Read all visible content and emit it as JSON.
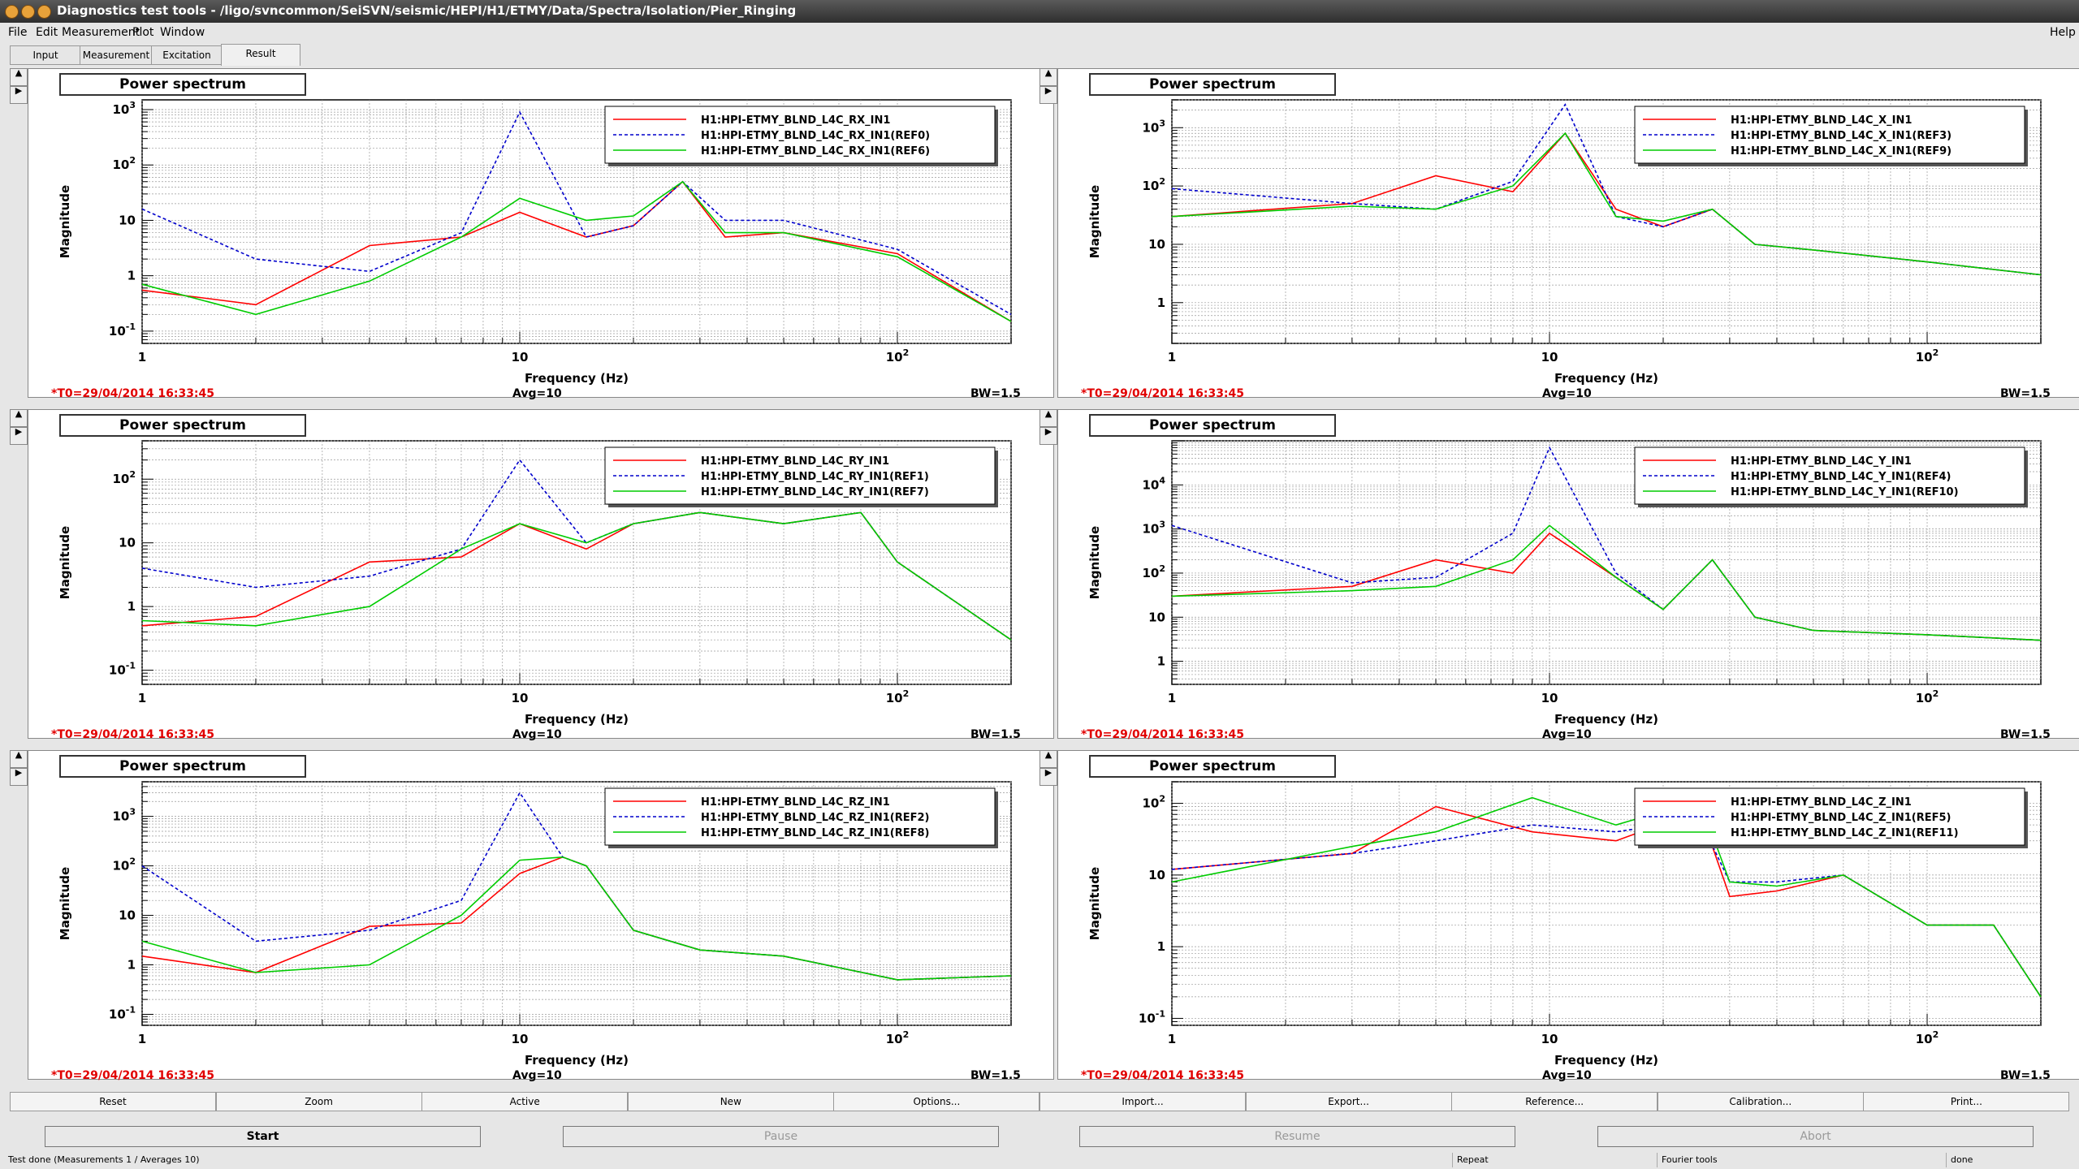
{
  "window": {
    "title": "Diagnostics test tools - /ligo/svncommon/SeiSVN/seismic/HEPI/H1/ETMY/Data/Spectra/Isolation/Pier_Ringing"
  },
  "menu": {
    "file": "File",
    "edit": "Edit",
    "measurement": "Measurement",
    "plot": "Plot",
    "window": "Window",
    "help": "Help"
  },
  "tabs": [
    "Input",
    "Measurement",
    "Excitation",
    "Result"
  ],
  "active_tab": "Result",
  "panel_button_up": "▲",
  "panel_button_right": "▶",
  "panels": [
    {
      "title": "Power spectrum",
      "ylabel": "Magnitude",
      "xlabel": "Frequency (Hz)",
      "t0": "*T0=29/04/2014 16:33:45",
      "avg": "Avg=10",
      "bw": "BW=1.5",
      "ydec": [
        -1,
        3
      ],
      "ytick": [
        "10^-1",
        "1",
        "10",
        "10^2",
        "10^3"
      ],
      "legend": [
        "H1:HPI-ETMY_BLND_L4C_RX_IN1",
        "H1:HPI-ETMY_BLND_L4C_RX_IN1(REF0)",
        "H1:HPI-ETMY_BLND_L4C_RX_IN1(REF6)"
      ]
    },
    {
      "title": "Power spectrum",
      "ylabel": "Magnitude",
      "xlabel": "Frequency (Hz)",
      "t0": "*T0=29/04/2014 16:33:45",
      "avg": "Avg=10",
      "bw": "BW=1.5",
      "ydec": [
        0,
        3
      ],
      "ytick": [
        "1",
        "10",
        "10^2",
        "10^3"
      ],
      "legend": [
        "H1:HPI-ETMY_BLND_L4C_X_IN1",
        "H1:HPI-ETMY_BLND_L4C_X_IN1(REF3)",
        "H1:HPI-ETMY_BLND_L4C_X_IN1(REF9)"
      ]
    },
    {
      "title": "Power spectrum",
      "ylabel": "Magnitude",
      "xlabel": "Frequency (Hz)",
      "t0": "*T0=29/04/2014 16:33:45",
      "avg": "Avg=10",
      "bw": "BW=1.5",
      "ydec": [
        -1,
        2
      ],
      "ytick": [
        "10^-1",
        "1",
        "10",
        "10^2"
      ],
      "legend": [
        "H1:HPI-ETMY_BLND_L4C_RY_IN1",
        "H1:HPI-ETMY_BLND_L4C_RY_IN1(REF1)",
        "H1:HPI-ETMY_BLND_L4C_RY_IN1(REF7)"
      ]
    },
    {
      "title": "Power spectrum",
      "ylabel": "Magnitude",
      "xlabel": "Frequency (Hz)",
      "t0": "*T0=29/04/2014 16:33:45",
      "avg": "Avg=10",
      "bw": "BW=1.5",
      "ydec": [
        0,
        4
      ],
      "ytick": [
        "1",
        "10",
        "10^2",
        "10^3",
        "10^4"
      ],
      "legend": [
        "H1:HPI-ETMY_BLND_L4C_Y_IN1",
        "H1:HPI-ETMY_BLND_L4C_Y_IN1(REF4)",
        "H1:HPI-ETMY_BLND_L4C_Y_IN1(REF10)"
      ]
    },
    {
      "title": "Power spectrum",
      "ylabel": "Magnitude",
      "xlabel": "Frequency (Hz)",
      "t0": "*T0=29/04/2014 16:33:45",
      "avg": "Avg=10",
      "bw": "BW=1.5",
      "ydec": [
        -1,
        3
      ],
      "ytick": [
        "10^-1",
        "1",
        "10",
        "10^2",
        "10^3"
      ],
      "legend": [
        "H1:HPI-ETMY_BLND_L4C_RZ_IN1",
        "H1:HPI-ETMY_BLND_L4C_RZ_IN1(REF2)",
        "H1:HPI-ETMY_BLND_L4C_RZ_IN1(REF8)"
      ]
    },
    {
      "title": "Power spectrum",
      "ylabel": "Magnitude",
      "xlabel": "Frequency (Hz)",
      "t0": "*T0=29/04/2014 16:33:45",
      "avg": "Avg=10",
      "bw": "BW=1.5",
      "ydec": [
        -1,
        2
      ],
      "ytick": [
        "10^-1",
        "1",
        "10",
        "10^2"
      ],
      "legend": [
        "H1:HPI-ETMY_BLND_L4C_Z_IN1",
        "H1:HPI-ETMY_BLND_L4C_Z_IN1(REF5)",
        "H1:HPI-ETMY_BLND_L4C_Z_IN1(REF11)"
      ]
    }
  ],
  "xticks": [
    "1",
    "10",
    "10^2"
  ],
  "series_colors": [
    "#ff0000",
    "#0000cc",
    "#00cc00"
  ],
  "actions": [
    "Reset",
    "Zoom",
    "Active",
    "New",
    "Options...",
    "Import...",
    "Export...",
    "Reference...",
    "Calibration...",
    "Print..."
  ],
  "run_buttons": {
    "start": "Start",
    "pause": "Pause",
    "resume": "Resume",
    "abort": "Abort"
  },
  "status": {
    "message": "Test done (Measurements 1 / Averages 10)",
    "repeat": "Repeat",
    "fourier": "Fourier tools",
    "state": "done"
  },
  "chart_data": [
    {
      "type": "line",
      "title": "Power spectrum",
      "xlabel": "Frequency (Hz)",
      "ylabel": "Magnitude",
      "xscale": "log",
      "yscale": "log",
      "xlim": [
        1,
        200
      ],
      "ylim": [
        0.06,
        1500
      ],
      "series": [
        {
          "name": "H1:HPI-ETMY_BLND_L4C_RX_IN1",
          "x": [
            1,
            2,
            4,
            7,
            10,
            15,
            20,
            27,
            35,
            50,
            100,
            200
          ],
          "y": [
            0.55,
            0.3,
            3.5,
            5,
            14,
            5,
            8,
            50,
            5,
            6,
            2.5,
            0.15
          ]
        },
        {
          "name": "H1:HPI-ETMY_BLND_L4C_RX_IN1(REF0)",
          "x": [
            1,
            2,
            4,
            7,
            10,
            15,
            20,
            27,
            35,
            50,
            100,
            200
          ],
          "y": [
            16,
            2,
            1.2,
            6,
            900,
            5,
            8,
            50,
            10,
            10,
            3,
            0.2
          ]
        },
        {
          "name": "H1:HPI-ETMY_BLND_L4C_RX_IN1(REF6)",
          "x": [
            1,
            2,
            4,
            7,
            10,
            15,
            20,
            27,
            35,
            50,
            100,
            200
          ],
          "y": [
            0.7,
            0.2,
            0.8,
            5,
            25,
            10,
            12,
            50,
            6,
            6,
            2.2,
            0.15
          ]
        }
      ]
    },
    {
      "type": "line",
      "title": "Power spectrum",
      "xlabel": "Frequency (Hz)",
      "ylabel": "Magnitude",
      "xscale": "log",
      "yscale": "log",
      "xlim": [
        1,
        200
      ],
      "ylim": [
        0.2,
        3000
      ],
      "series": [
        {
          "name": "H1:HPI-ETMY_BLND_L4C_X_IN1",
          "x": [
            1,
            3,
            5,
            8,
            11,
            15,
            20,
            27,
            35,
            50,
            100,
            200
          ],
          "y": [
            30,
            50,
            150,
            80,
            800,
            40,
            20,
            40,
            10,
            8,
            5,
            3
          ]
        },
        {
          "name": "H1:HPI-ETMY_BLND_L4C_X_IN1(REF3)",
          "x": [
            1,
            3,
            5,
            8,
            11,
            15,
            20,
            27,
            35,
            50,
            100,
            200
          ],
          "y": [
            90,
            50,
            40,
            120,
            2500,
            30,
            20,
            40,
            10,
            8,
            5,
            3
          ]
        },
        {
          "name": "H1:HPI-ETMY_BLND_L4C_X_IN1(REF9)",
          "x": [
            1,
            3,
            5,
            8,
            11,
            15,
            20,
            27,
            35,
            50,
            100,
            200
          ],
          "y": [
            30,
            45,
            40,
            100,
            800,
            30,
            25,
            40,
            10,
            8,
            5,
            3
          ]
        }
      ]
    },
    {
      "type": "line",
      "title": "Power spectrum",
      "xlabel": "Frequency (Hz)",
      "ylabel": "Magnitude",
      "xscale": "log",
      "yscale": "log",
      "xlim": [
        1,
        200
      ],
      "ylim": [
        0.06,
        400
      ],
      "series": [
        {
          "name": "H1:HPI-ETMY_BLND_L4C_RY_IN1",
          "x": [
            1,
            2,
            4,
            7,
            10,
            15,
            20,
            30,
            50,
            80,
            100,
            200
          ],
          "y": [
            0.5,
            0.7,
            5,
            6,
            20,
            8,
            20,
            30,
            20,
            30,
            5,
            0.3
          ]
        },
        {
          "name": "H1:HPI-ETMY_BLND_L4C_RY_IN1(REF1)",
          "x": [
            1,
            2,
            4,
            7,
            10,
            15,
            20,
            30,
            50,
            80,
            100,
            200
          ],
          "y": [
            4,
            2,
            3,
            8,
            200,
            10,
            20,
            30,
            20,
            30,
            5,
            0.3
          ]
        },
        {
          "name": "H1:HPI-ETMY_BLND_L4C_RY_IN1(REF7)",
          "x": [
            1,
            2,
            4,
            7,
            10,
            15,
            20,
            30,
            50,
            80,
            100,
            200
          ],
          "y": [
            0.6,
            0.5,
            1,
            8,
            20,
            10,
            20,
            30,
            20,
            30,
            5,
            0.3
          ]
        }
      ]
    },
    {
      "type": "line",
      "title": "Power spectrum",
      "xlabel": "Frequency (Hz)",
      "ylabel": "Magnitude",
      "xscale": "log",
      "yscale": "log",
      "xlim": [
        1,
        200
      ],
      "ylim": [
        0.3,
        100000
      ],
      "series": [
        {
          "name": "H1:HPI-ETMY_BLND_L4C_Y_IN1",
          "x": [
            1,
            3,
            5,
            8,
            10,
            15,
            20,
            27,
            35,
            50,
            100,
            200
          ],
          "y": [
            30,
            50,
            200,
            100,
            800,
            80,
            15,
            200,
            10,
            5,
            4,
            3
          ]
        },
        {
          "name": "H1:HPI-ETMY_BLND_L4C_Y_IN1(REF4)",
          "x": [
            1,
            3,
            5,
            8,
            10,
            15,
            20,
            27,
            35,
            50,
            100,
            200
          ],
          "y": [
            1200,
            60,
            80,
            800,
            70000,
            100,
            15,
            200,
            10,
            5,
            4,
            3
          ]
        },
        {
          "name": "H1:HPI-ETMY_BLND_L4C_Y_IN1(REF10)",
          "x": [
            1,
            3,
            5,
            8,
            10,
            15,
            20,
            27,
            35,
            50,
            100,
            200
          ],
          "y": [
            30,
            40,
            50,
            200,
            1200,
            80,
            15,
            200,
            10,
            5,
            4,
            3
          ]
        }
      ]
    },
    {
      "type": "line",
      "title": "Power spectrum",
      "xlabel": "Frequency (Hz)",
      "ylabel": "Magnitude",
      "xscale": "log",
      "yscale": "log",
      "xlim": [
        1,
        200
      ],
      "ylim": [
        0.06,
        5000
      ],
      "series": [
        {
          "name": "H1:HPI-ETMY_BLND_L4C_RZ_IN1",
          "x": [
            1,
            2,
            4,
            7,
            10,
            13,
            15,
            20,
            30,
            50,
            100,
            200
          ],
          "y": [
            1.5,
            0.7,
            6,
            7,
            70,
            150,
            100,
            5,
            2,
            1.5,
            0.5,
            0.6
          ]
        },
        {
          "name": "H1:HPI-ETMY_BLND_L4C_RZ_IN1(REF2)",
          "x": [
            1,
            2,
            4,
            7,
            10,
            13,
            15,
            20,
            30,
            50,
            100,
            200
          ],
          "y": [
            100,
            3,
            5,
            20,
            3000,
            150,
            100,
            5,
            2,
            1.5,
            0.5,
            0.6
          ]
        },
        {
          "name": "H1:HPI-ETMY_BLND_L4C_RZ_IN1(REF8)",
          "x": [
            1,
            2,
            4,
            7,
            10,
            13,
            15,
            20,
            30,
            50,
            100,
            200
          ],
          "y": [
            3,
            0.7,
            1,
            10,
            130,
            150,
            100,
            5,
            2,
            1.5,
            0.5,
            0.6
          ]
        }
      ]
    },
    {
      "type": "line",
      "title": "Power spectrum",
      "xlabel": "Frequency (Hz)",
      "ylabel": "Magnitude",
      "xscale": "log",
      "yscale": "log",
      "xlim": [
        1,
        200
      ],
      "ylim": [
        0.08,
        200
      ],
      "series": [
        {
          "name": "H1:HPI-ETMY_BLND_L4C_Z_IN1",
          "x": [
            1,
            3,
            5,
            9,
            15,
            25,
            30,
            40,
            60,
            100,
            150,
            200
          ],
          "y": [
            12,
            20,
            90,
            40,
            30,
            80,
            5,
            6,
            10,
            2,
            2,
            0.2
          ]
        },
        {
          "name": "H1:HPI-ETMY_BLND_L4C_Z_IN1(REF5)",
          "x": [
            1,
            3,
            5,
            9,
            15,
            25,
            30,
            40,
            60,
            100,
            150,
            200
          ],
          "y": [
            12,
            20,
            30,
            50,
            40,
            60,
            8,
            8,
            10,
            2,
            2,
            0.2
          ]
        },
        {
          "name": "H1:HPI-ETMY_BLND_L4C_Z_IN1(REF11)",
          "x": [
            1,
            3,
            5,
            9,
            15,
            25,
            30,
            40,
            60,
            100,
            150,
            200
          ],
          "y": [
            8,
            25,
            40,
            120,
            50,
            110,
            8,
            7,
            10,
            2,
            2,
            0.2
          ]
        }
      ]
    }
  ]
}
